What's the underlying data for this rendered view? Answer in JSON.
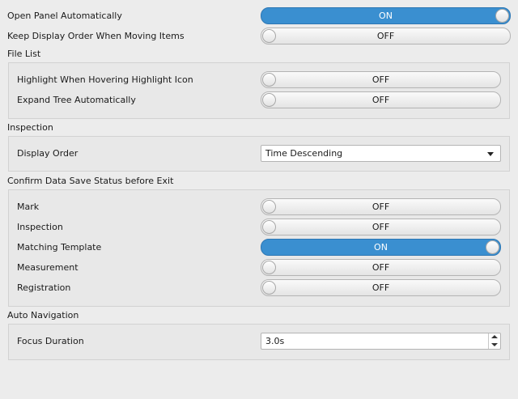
{
  "top": {
    "open_panel": {
      "label": "Open Panel Automatically",
      "state": "ON"
    },
    "keep_order": {
      "label": "Keep Display Order When Moving Items",
      "state": "OFF"
    }
  },
  "file_list": {
    "title": "File List",
    "highlight": {
      "label": "Highlight When Hovering Highlight Icon",
      "state": "OFF"
    },
    "expand_tree": {
      "label": "Expand Tree Automatically",
      "state": "OFF"
    }
  },
  "inspection": {
    "title": "Inspection",
    "display_order": {
      "label": "Display Order",
      "value": "Time Descending"
    }
  },
  "confirm_save": {
    "title": "Confirm Data Save Status before Exit",
    "mark": {
      "label": "Mark",
      "state": "OFF"
    },
    "inspection": {
      "label": "Inspection",
      "state": "OFF"
    },
    "matching_template": {
      "label": "Matching Template",
      "state": "ON"
    },
    "measurement": {
      "label": "Measurement",
      "state": "OFF"
    },
    "registration": {
      "label": "Registration",
      "state": "OFF"
    }
  },
  "auto_navigation": {
    "title": "Auto Navigation",
    "focus_duration": {
      "label": "Focus Duration",
      "value": "3.0s"
    }
  },
  "colors": {
    "toggle_on": "#3a8fd0"
  }
}
